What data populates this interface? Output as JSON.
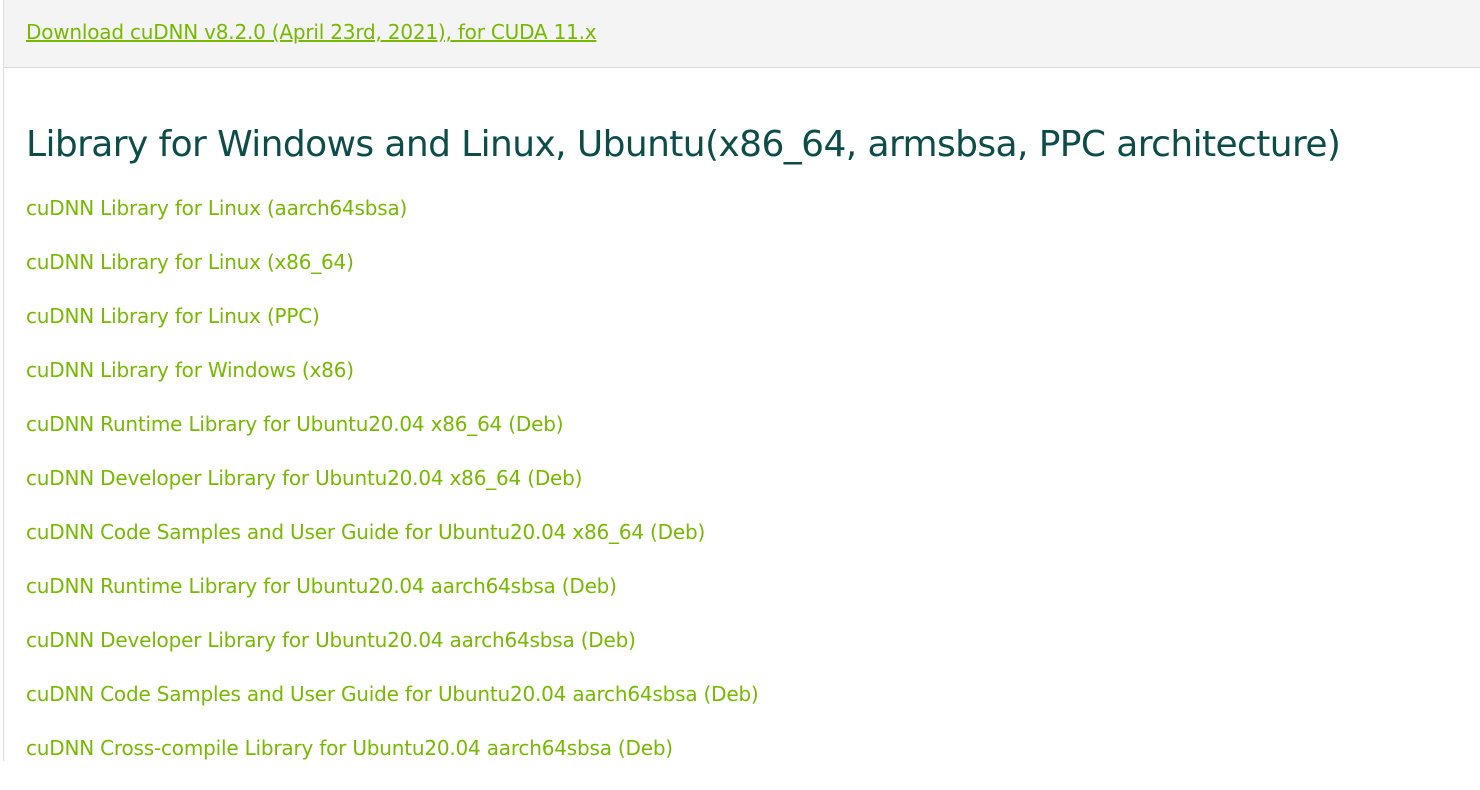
{
  "header": {
    "download_link": "Download cuDNN v8.2.0 (April 23rd, 2021), for CUDA 11.x"
  },
  "section": {
    "title": "Library for Windows and Linux, Ubuntu(x86_64, armsbsa, PPC architecture)",
    "links": [
      "cuDNN Library for Linux (aarch64sbsa)",
      "cuDNN Library for Linux (x86_64)",
      "cuDNN Library for Linux (PPC)",
      "cuDNN Library for Windows (x86)",
      "cuDNN Runtime Library for Ubuntu20.04 x86_64 (Deb)",
      "cuDNN Developer Library for Ubuntu20.04 x86_64 (Deb)",
      "cuDNN Code Samples and User Guide for Ubuntu20.04 x86_64 (Deb)",
      "cuDNN Runtime Library for Ubuntu20.04 aarch64sbsa (Deb)",
      "cuDNN Developer Library for Ubuntu20.04 aarch64sbsa (Deb)",
      "cuDNN Code Samples and User Guide for Ubuntu20.04 aarch64sbsa (Deb)",
      "cuDNN Cross-compile Library for Ubuntu20.04 aarch64sbsa (Deb)"
    ]
  },
  "colors": {
    "link_green": "#76b900",
    "title_teal": "#0c4d4a",
    "header_bg": "#f4f4f4"
  }
}
